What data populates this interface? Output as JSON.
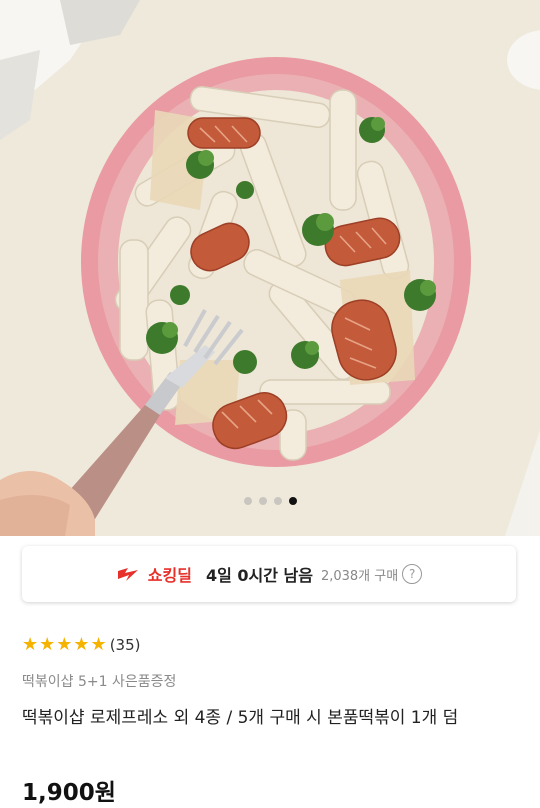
{
  "hero": {
    "image_alt": "로제 떡볶이 plate with sausages and broccoli",
    "carousel": {
      "total": 4,
      "active_index": 3
    }
  },
  "deal": {
    "icon": "shocking-deal-icon",
    "name": "쇼킹딜",
    "time_left": "4일 0시간 남음",
    "purchase_count": "2,038개 구매",
    "info_icon": "?"
  },
  "product": {
    "stars": "★★★★★",
    "review_count": "(35)",
    "brand": "떡볶이샵 5+1 사은품증정",
    "title": "떡볶이샵 로제프레소 외 4종 / 5개 구매 시 본품떡볶이 1개 덤",
    "price": "1,900",
    "price_unit": "원"
  },
  "colors": {
    "deal_red": "#e7302a",
    "star_yellow": "#f5b300"
  }
}
